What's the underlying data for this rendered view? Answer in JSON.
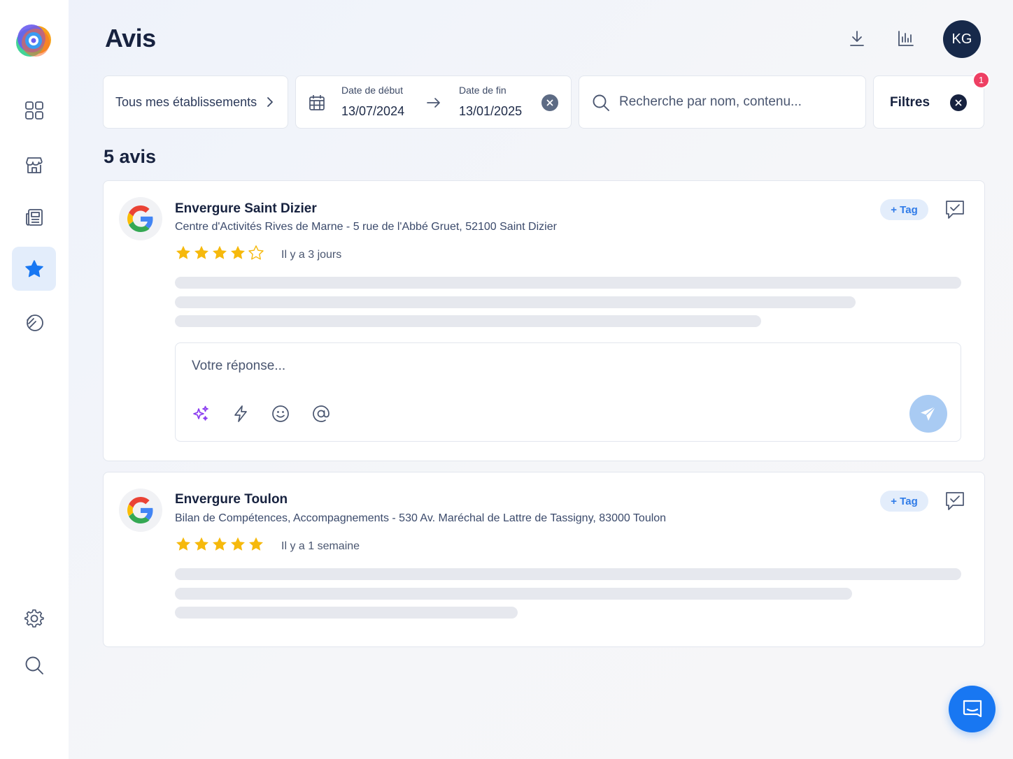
{
  "header": {
    "title": "Avis",
    "avatar_initials": "KG",
    "icons": [
      "download-icon",
      "chart-icon"
    ]
  },
  "sidebar": {
    "items": [
      {
        "icon": "dashboard-grid-icon"
      },
      {
        "icon": "store-icon"
      },
      {
        "icon": "newspaper-icon"
      },
      {
        "icon": "star-icon",
        "active": true
      },
      {
        "icon": "hands-icon"
      },
      {
        "icon": "settings-gear-icon"
      },
      {
        "icon": "search-icon"
      }
    ]
  },
  "filters": {
    "establishments_label": "Tous mes établissements",
    "start_label": "Date de début",
    "start_value": "13/07/2024",
    "end_label": "Date de fin",
    "end_value": "13/01/2025",
    "search_placeholder": "Recherche par nom, contenu...",
    "filters_label": "Filtres",
    "filters_badge": "1"
  },
  "reviews_count": "5 avis",
  "reviews": [
    {
      "name": "Envergure Saint Dizier",
      "address": "Centre d'Activités Rives de Marne - 5 rue de l'Abbé Gruet, 52100 Saint Dizier",
      "rating": 4,
      "time": "Il y a 3 jours",
      "tag_label": "+ Tag",
      "reply_placeholder": "Votre réponse..."
    },
    {
      "name": "Envergure Toulon",
      "address": "Bilan de Compétences, Accompagnements - 530 Av. Maréchal de Lattre de Tassigny, 83000 Toulon",
      "rating": 5,
      "time": "Il y a 1 semaine",
      "tag_label": "+ Tag"
    }
  ],
  "colors": {
    "accent": "#2f7be8",
    "star": "#f6b90c",
    "avatar_bg": "#17294a",
    "badge": "#ee3f63"
  }
}
